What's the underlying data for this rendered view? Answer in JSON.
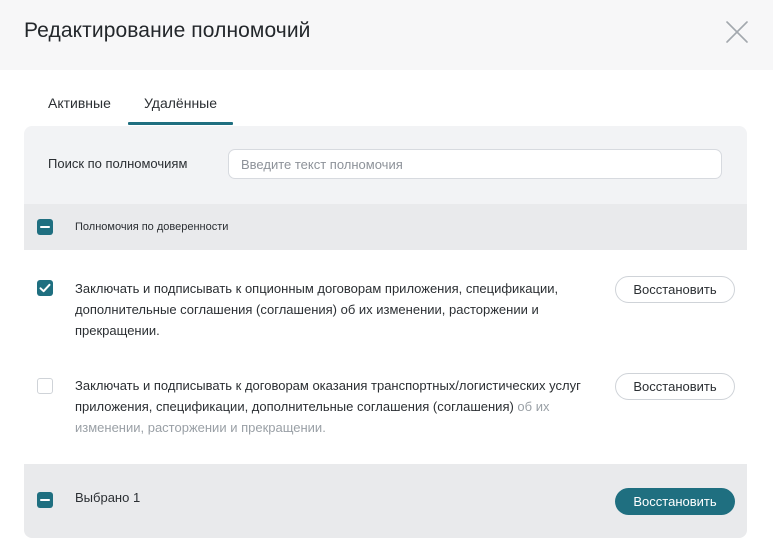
{
  "modal": {
    "title": "Редактирование полномочий",
    "close_icon": "close-icon"
  },
  "tabs": [
    {
      "label": "Активные",
      "active": false
    },
    {
      "label": "Удалённые",
      "active": true
    }
  ],
  "search": {
    "label": "Поиск по полномочиям",
    "placeholder": "Введите текст полномочия",
    "value": ""
  },
  "group": {
    "label": "Полномочия по доверенности",
    "checkbox_state": "indeterminate"
  },
  "items": [
    {
      "text": "Заключать и подписывать к опционным договорам приложения, спецификации, дополнительные соглашения (соглашения) об их изменении, расторжении и прекращении.",
      "checked": true,
      "button_label": "Восстановить"
    },
    {
      "text_main": "Заключать и подписывать к договорам оказания транспортных/логистических услуг приложения, спецификации, дополнительные соглашения (соглашения) ",
      "text_tail": "об их изменении, расторжении и прекращении.",
      "checked": false,
      "button_label": "Восстановить"
    }
  ],
  "footer": {
    "selected_label": "Выбрано 1",
    "checkbox_state": "indeterminate",
    "button_label": "Восстановить"
  },
  "colors": {
    "accent": "#1f6f80",
    "header_bg": "#f7f7f8",
    "panel_gray": "#e9eaec"
  }
}
